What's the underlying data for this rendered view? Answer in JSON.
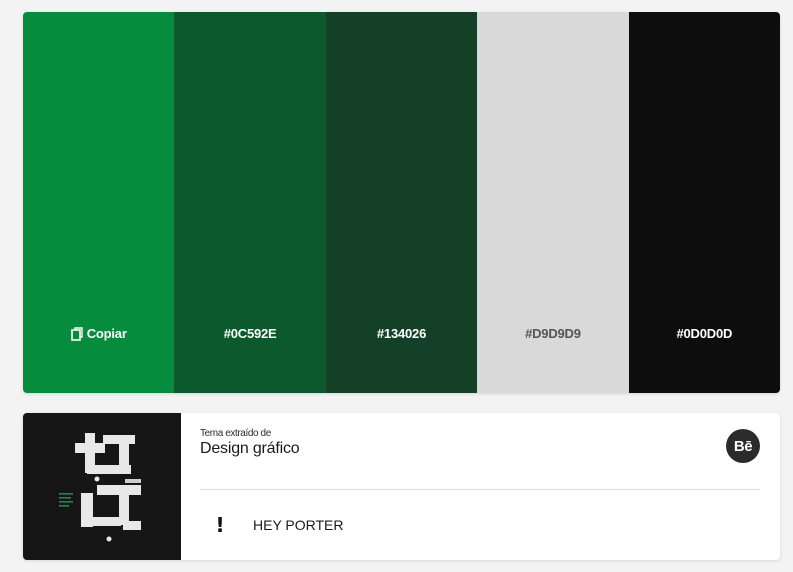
{
  "palette": {
    "swatches": [
      {
        "color": "#068C3D",
        "label": "Copiar",
        "label_color": "#ffffff",
        "icon": "copy-icon"
      },
      {
        "color": "#0C592E",
        "label": "#0C592E",
        "label_color": "#ffffff"
      },
      {
        "color": "#134026",
        "label": "#134026",
        "label_color": "#ffffff"
      },
      {
        "color": "#D9D9D9",
        "label": "#D9D9D9",
        "label_color": "#555555"
      },
      {
        "color": "#0D0D0D",
        "label": "#0D0D0D",
        "label_color": "#ffffff"
      }
    ]
  },
  "source_card": {
    "extracted_label": "Tema extraído de",
    "category": "Design gráfico",
    "platform_badge": "Bē",
    "author_icon": "!",
    "author_name": "HEY PORTER",
    "thumbnail_icon": "arabic-calligraphy-artwork"
  }
}
